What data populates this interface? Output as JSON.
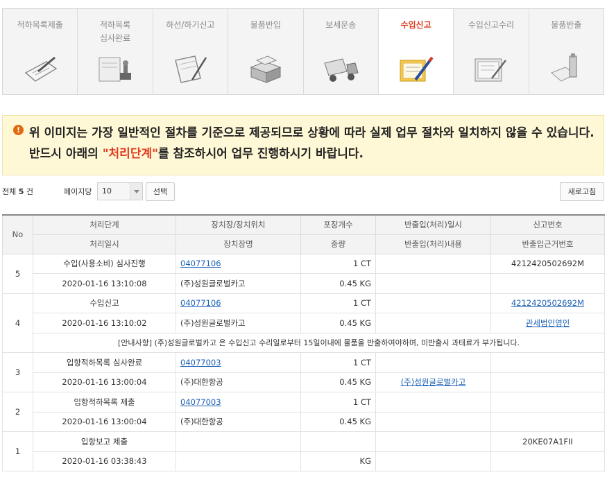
{
  "steps": [
    {
      "label": "적하목록제출",
      "icon": "document-pen-icon"
    },
    {
      "label": "적하목록\n심사완료",
      "icon": "stamp-icon"
    },
    {
      "label": "하선/하기신고",
      "icon": "clipboard-pen-icon"
    },
    {
      "label": "물품반입",
      "icon": "boxes-icon"
    },
    {
      "label": "보세운송",
      "icon": "truck-icon"
    },
    {
      "label": "수입신고",
      "icon": "report-pen-icon"
    },
    {
      "label": "수입신고수리",
      "icon": "approved-document-icon"
    },
    {
      "label": "물품반출",
      "icon": "documents-bottle-icon"
    }
  ],
  "active_step": "수입신고",
  "notice": {
    "before": "위 이미지는 가장 일반적인 절차를 기준으로 제공되므로 상황에 따라 실제 업무 절차와 일치하지 않을 수 있습니다. 반드시 아래의 ",
    "highlight": "\"처리단계\"",
    "after": "를 참조하시어 업무 진행하시기 바랍니다."
  },
  "toolbar": {
    "total_prefix": "전체 ",
    "total_count": "5",
    "total_suffix": " 건",
    "per_page_label": "페이지당",
    "per_page_value": "10",
    "select_button": "선택",
    "refresh_button": "새로고침"
  },
  "table": {
    "headers_row1": [
      "No",
      "처리단계",
      "장치장/장치위치",
      "포장개수",
      "반출입(처리)일시",
      "신고번호"
    ],
    "headers_row2": [
      "처리일시",
      "장치장명",
      "중량",
      "반출입(처리)내용",
      "반출입근거번호"
    ],
    "rows": [
      {
        "no": "5",
        "step": "수입(사용소비) 심사진행",
        "location": "04077106",
        "packages": "1 CT",
        "io_datetime": "",
        "report_no": "4212420502692M",
        "datetime": "2020-01-16 13:10:08",
        "warehouse": "(주)성원글로벌카고",
        "weight": "0.45 KG",
        "io_content": "",
        "basis_no": ""
      },
      {
        "no": "4",
        "step": "수입신고",
        "location": "04077106",
        "packages": "1 CT",
        "io_datetime": "",
        "report_no": "4212420502692M",
        "datetime": "2020-01-16 13:10:02",
        "warehouse": "(주)성원글로벌카고",
        "weight": "0.45 KG",
        "io_content": "",
        "basis_no": "관세법인영인",
        "notice": "[안내사항] (주)성원글로벌카고 은 수입신고 수리일로부터 15일이내에 물품을 반출하여야하며, 미반출시 과태료가 부가됩니다."
      },
      {
        "no": "3",
        "step": "입항적하목록 심사완료",
        "location": "04077003",
        "packages": "1 CT",
        "io_datetime": "",
        "report_no": "",
        "datetime": "2020-01-16 13:00:04",
        "warehouse": "(주)대한항공",
        "weight": "0.45 KG",
        "io_content": "(주)성원글로벌카고",
        "basis_no": ""
      },
      {
        "no": "2",
        "step": "입항적하목록 제출",
        "location": "04077003",
        "packages": "1 CT",
        "io_datetime": "",
        "report_no": "",
        "datetime": "2020-01-16 13:00:04",
        "warehouse": "(주)대한항공",
        "weight": "0.45 KG",
        "io_content": "",
        "basis_no": ""
      },
      {
        "no": "1",
        "step": "입항보고 제출",
        "location": "",
        "packages": "",
        "io_datetime": "",
        "report_no": "20KE07A1FII",
        "datetime": "2020-01-16 03:38:43",
        "warehouse": "",
        "weight": "KG",
        "io_content": "",
        "basis_no": ""
      }
    ]
  }
}
